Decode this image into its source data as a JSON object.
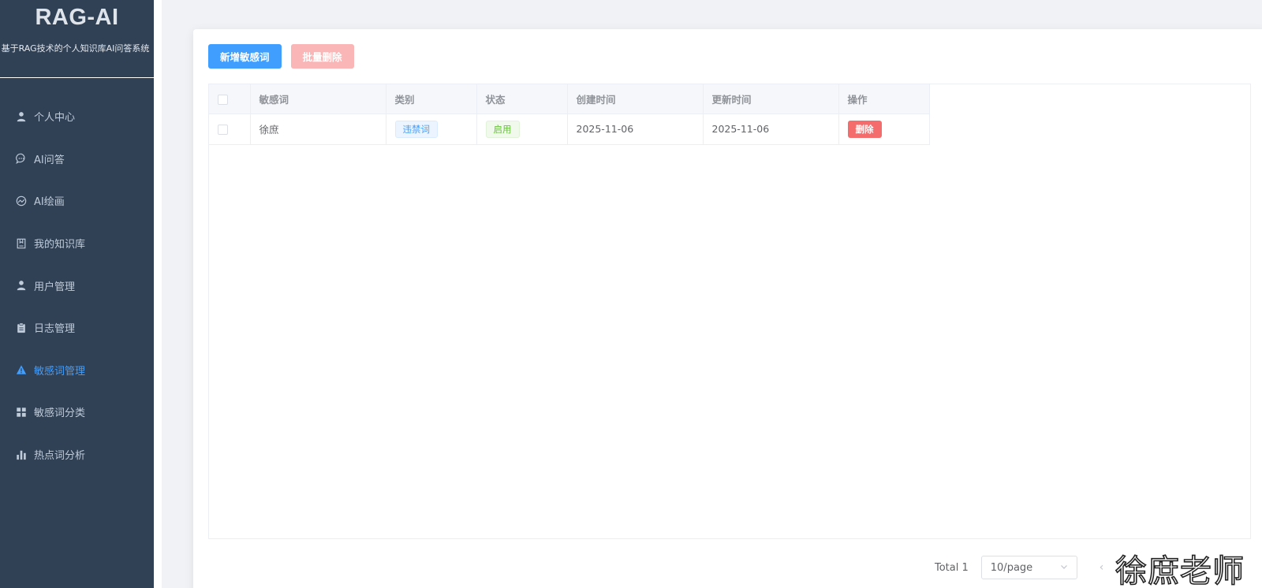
{
  "brand": {
    "title": "RAG-AI",
    "subtitle": "基于RAG技术的个人知识库AI问答系统"
  },
  "menu": [
    {
      "label": "个人中心",
      "icon": "user-icon",
      "active": false
    },
    {
      "label": "AI问答",
      "icon": "chat-bubble-icon",
      "active": false
    },
    {
      "label": "AI绘画",
      "icon": "paint-icon",
      "active": false
    },
    {
      "label": "我的知识库",
      "icon": "notebook-icon",
      "active": false
    },
    {
      "label": "用户管理",
      "icon": "user-icon",
      "active": false
    },
    {
      "label": "日志管理",
      "icon": "clipboard-icon",
      "active": false
    },
    {
      "label": "敏感词管理",
      "icon": "warning-icon",
      "active": true
    },
    {
      "label": "敏感词分类",
      "icon": "grid-icon",
      "active": false
    },
    {
      "label": "热点词分析",
      "icon": "bar-chart-icon",
      "active": false
    }
  ],
  "toolbar": {
    "add_label": "新增敏感词",
    "batch_delete_label": "批量删除"
  },
  "table": {
    "columns": [
      "敏感词",
      "类别",
      "状态",
      "创建时间",
      "更新时间",
      "操作"
    ],
    "rows": [
      {
        "word": "徐庶",
        "category": "违禁词",
        "status": "启用",
        "created": "2025-11-06",
        "updated": "2025-11-06",
        "action": "删除"
      }
    ]
  },
  "pagination": {
    "total": "Total 1",
    "page_size": "10/page",
    "prev": "‹"
  },
  "watermark": "徐庶老师",
  "colors": {
    "sidebar_bg": "#304156",
    "active": "#409eff",
    "danger": "#f56c6c"
  }
}
